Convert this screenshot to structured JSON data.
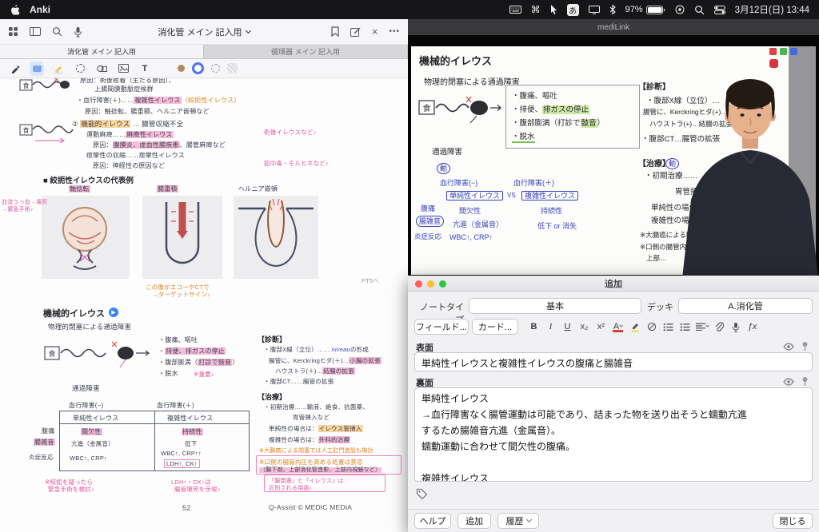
{
  "menubar": {
    "app": "Anki",
    "command": "⌘",
    "ime": "あ",
    "battery": "97%",
    "clock": "3月12日(日) 13:44"
  },
  "gn": {
    "title": "消化管 メイン 記入用",
    "tab_active": "消化管 メイン 記入用",
    "tab_inactive": "循環器 メイン 記入用",
    "text_tool": "T",
    "page": "52",
    "credit": "Q-Assist © MEDIC MEDIA",
    "s1": {
      "l1": "原因：術後癒着（主たる原因）、",
      "l2": "上腸間膜動脈症候群",
      "l3a": "・血行障害(＋)……",
      "l3b": "複雑性イレウス",
      "l3c": "（絞扼性イレウス）",
      "l4": "原因：軸捻転、腸重積、ヘルニア嵌頓など",
      "l5a": "② ",
      "l5b": "機能的イレウス",
      "l5c": " … 腸管収縮不全",
      "l6a": "運動麻痺……",
      "l6b": "麻痺性イレウス",
      "l7a": "原因：",
      "l7b": "腹膜炎、虚血性腸疾患",
      "l7c": "、腸管麻痺など",
      "l8": "痙攣性の収縮……痙攣性イレウス",
      "l9": "原因：神経性の原因など",
      "ann1": "術後イレウスなど♪",
      "ann2": "鉛中毒・モルヒネなど♪",
      "food": "食"
    },
    "s2": {
      "header": "■ 絞扼性イレウスの代表例",
      "cap1": "軸捻転",
      "cap2": "腸重積",
      "cap3": "ヘルニア嵌頓",
      "annL1": "血流うっ血→壊死",
      "annL2": "→緊急手術♪",
      "annM1": "この像がエコーやCTで",
      "annM2": "→ターゲットサイン♪",
      "pt5": "PT5へ"
    },
    "s3": {
      "header": "機械的イレウス",
      "sub": "物理的閉塞による通過障害",
      "food": "食",
      "passage": "通過障害",
      "sy1": "・腹痛、嘔吐",
      "sy2a": "・",
      "sy2b": "排便、排ガスの停止",
      "sy3a": "・腹部膨満（",
      "sy3b": "打診で鼓音",
      "sy3c": "）",
      "sy4": "・脱水",
      "important": "※重要♪",
      "dx_h": "【診断】",
      "dx1a": "・腹部X線（立位）…… ",
      "dx1b": "niveau",
      "dx1c": "の形成",
      "dx2a": "腸管に、Kerckringヒダ(＋)…",
      "dx2b": "小腸の拡張",
      "dx3a": "ハウストラ(＋)…",
      "dx3b": "結腸の拡張",
      "dx4": "・腹部CT……腸管の拡張",
      "tx_h": "【治療】",
      "tx1": "・初期治療……輸液、絶食、抗菌薬、",
      "tx1b": "胃管挿入など",
      "tx2a": "単純性の場合は：",
      "tx2b": "イレウス管挿入",
      "tx3a": "複雑性の場合は：",
      "tx3b": "外科的治療",
      "tx4": "※大腸癌による閉塞では人工肛門造設も検討",
      "tx5": "※口側の腸管内圧を高める処置は禁忌",
      "tx6": "（腸下剤、上部消化管造影、上部内視鏡など）"
    },
    "tbl": {
      "h_neg": "血行障害(−)",
      "h_pos": "血行障害(＋)",
      "c1": "単純性イレウス",
      "c2": "複雑性イレウス",
      "r1": "腹痛",
      "r2": "腸雑音",
      "r3": "炎症反応",
      "s1": "間欠性",
      "s2": "亢進（金属音）",
      "s3": "WBC↑, CRP↑",
      "x1": "持続性",
      "x2": "低下",
      "x3": "WBC↑, CRP↑↑",
      "x4": "LDH↑, CK↑"
    },
    "btm": {
      "a1": "※絞扼を疑ったら",
      "a2": "緊急手術を検討♪",
      "b1": "LDH↑・CK↑は",
      "b2": "腸管壊死を示唆♪",
      "c1": "「腸閉塞」と「イレウス」は",
      "c2": "区別される用語♪"
    }
  },
  "video": {
    "window_title": "mediLink",
    "slide": {
      "title": "機械的イレウス",
      "sub": "物理的閉塞による通過障害",
      "food": "食",
      "passage": "通過障害",
      "sy1": "・腹痛、嘔吐",
      "sy2a": "・排便、",
      "sy2b": "排ガスの停止",
      "sy3a": "・腹部膨満（打診で",
      "sy3b": "鼓音",
      "sy3c": "）",
      "sy4": "・脱水",
      "dx_h": "【診断】",
      "dx1": "・腹部X線（立位）…",
      "dx2": "腸管に、Kerckringヒダ(+)…小腸の拡張",
      "dx3": "ハウストラ(+)…結腸の拡張",
      "dx4": "・腹部CT…腸管の拡張",
      "tx_h": "【治療】",
      "tx1": "・初期治療……",
      "tx1b": "胃管挿入など",
      "tx2": "単純性の場合は…",
      "tx3": "複雑性の場合は…",
      "tx4": "※大腸癌による閉塞…",
      "tx5": "※口側の腸管内圧を…",
      "tx6": "上部…",
      "hw": {
        "dou1": "動",
        "dou2": "動",
        "neg": "血行障害(−)",
        "pos": "血行障害(＋)",
        "simple": "単純性イレウス",
        "vs": "VS",
        "complex": "複雑性イレウス",
        "pain": "腹痛",
        "int": "間欠性",
        "cont": "持続性",
        "sound": "腸雑音",
        "up": "亢進（金属音）",
        "down": "低下 or 消失",
        "lab": "WBC↑, CRP↑",
        "inflam": "炎症反応"
      }
    }
  },
  "anki": {
    "window_title": "追加",
    "note_type_label": "ノートタイプ",
    "note_type": "基本",
    "deck_label": "デッキ",
    "deck": "A.消化管",
    "fields_btn": "フィールド...",
    "cards_btn": "カード...",
    "fmt": {
      "bold": "B",
      "italic": "I",
      "underline": "U",
      "sub": "x₂",
      "sup": "x²",
      "color": "A",
      "fx": "ƒx"
    },
    "front_label": "表面",
    "front": "単純性イレウスと複雑性イレウスの腹痛と腸雑音",
    "back_label": "裏面",
    "back": "単純性イレウス\n→血行障害なく腸管運動は可能であり、詰まった物を送り出そうと蠕動亢進\nするため腸雑音亢進（金属音）。\n蠕動運動に合わせて間欠性の腹痛。\n\n複雑性イレウス",
    "help_btn": "ヘルプ",
    "add_btn": "追加",
    "history_btn": "履歴",
    "close_btn": "閉じる"
  }
}
